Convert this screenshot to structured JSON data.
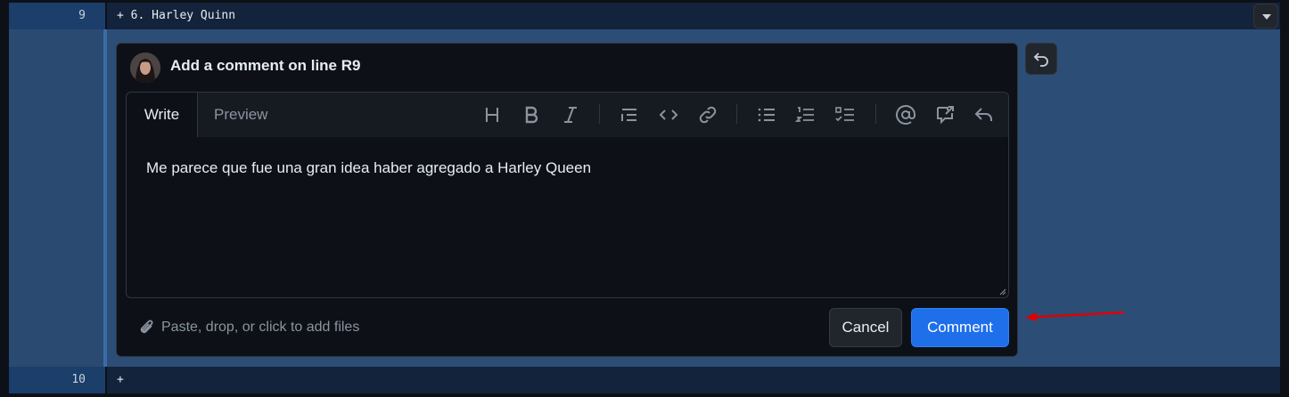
{
  "diff": {
    "line9_number": "9",
    "line9_code": "+ 6. Harley Quinn",
    "line10_number": "10",
    "line10_code": "+"
  },
  "comment": {
    "header_title": "Add a comment on line R9",
    "tabs": [
      "Write",
      "Preview"
    ],
    "toolbar_icons": [
      "heading-icon",
      "bold-icon",
      "italic-icon",
      "quote-icon",
      "code-icon",
      "link-icon",
      "unordered-list-icon",
      "ordered-list-icon",
      "task-list-icon",
      "mention-icon",
      "reference-icon",
      "reply-icon"
    ],
    "text": "Me parece que fue una gran idea haber agregado a Harley Queen",
    "attach_label": "Paste, drop, or click to add files",
    "cancel_label": "Cancel",
    "comment_label": "Comment"
  },
  "colors": {
    "accent": "#1f6feb",
    "annotation_arrow": "#e00000"
  }
}
